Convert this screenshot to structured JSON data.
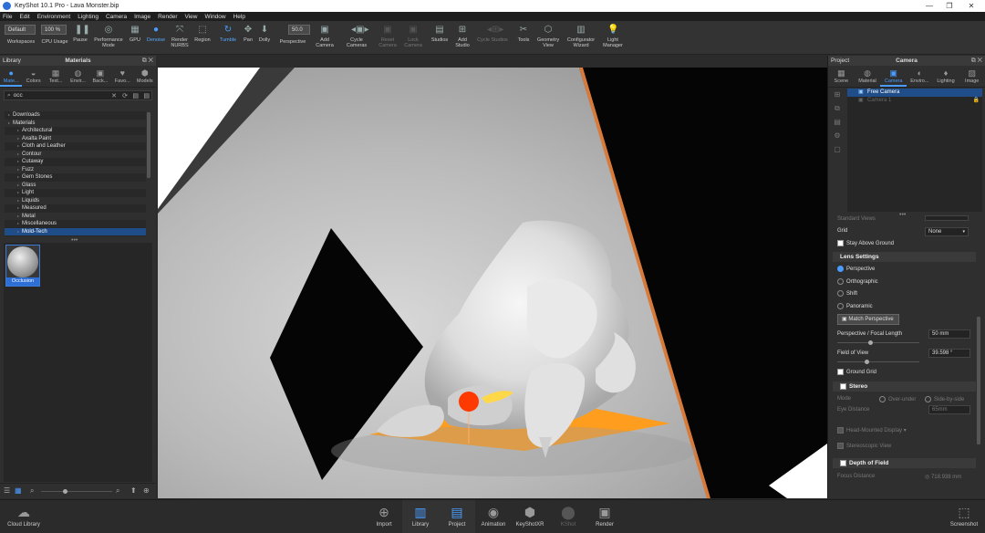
{
  "window": {
    "title": "KeyShot 10.1 Pro  - Lava Monster.bip",
    "minimize": "—",
    "maximize": "❐",
    "close": "✕"
  },
  "menu": [
    "File",
    "Edit",
    "Environment",
    "Lighting",
    "Camera",
    "Image",
    "Render",
    "View",
    "Window",
    "Help"
  ],
  "toolbar": {
    "workspace_value": "Default",
    "workspaces": "Workspaces",
    "cpu_value": "100 %",
    "cpu_usage": "CPU Usage",
    "pause": "Pause",
    "performance_mode": "Performance Mode",
    "gpu": "GPU",
    "denoise": "Denoise",
    "render_nurbs": "Render NURBS",
    "region": "Region",
    "tumble": "Tumble",
    "pan": "Pan",
    "dolly": "Dolly",
    "perspective_value": "50.0",
    "perspective": "Perspective",
    "add_camera": "Add Camera",
    "cycle_cameras": "Cycle Cameras",
    "reset_camera": "Reset Camera",
    "lock_camera": "Lock Camera",
    "studios": "Studios",
    "add_studio": "Add Studio",
    "cycle_studios": "Cycle Studios",
    "tools": "Tools",
    "geometry_view": "Geometry View",
    "configurator_wizard": "Configurator Wizard",
    "light_manager": "Light Manager"
  },
  "library": {
    "panel_label": "Library",
    "title": "Materials",
    "tabs": [
      "Mate...",
      "Colors",
      "Text...",
      "Envir...",
      "Back...",
      "Favo...",
      "Models"
    ],
    "search_value": "occ",
    "tree": [
      {
        "label": "Downloads",
        "depth": 0
      },
      {
        "label": "Materials",
        "depth": 0
      },
      {
        "label": "Architectural",
        "depth": 1
      },
      {
        "label": "Axalta Paint",
        "depth": 1
      },
      {
        "label": "Cloth and Leather",
        "depth": 1
      },
      {
        "label": "Contour",
        "depth": 1
      },
      {
        "label": "Cutaway",
        "depth": 1
      },
      {
        "label": "Fuzz",
        "depth": 1
      },
      {
        "label": "Gem Stones",
        "depth": 1
      },
      {
        "label": "Glass",
        "depth": 1
      },
      {
        "label": "Light",
        "depth": 1
      },
      {
        "label": "Liquids",
        "depth": 1
      },
      {
        "label": "Measured",
        "depth": 1
      },
      {
        "label": "Metal",
        "depth": 1
      },
      {
        "label": "Miscellaneous",
        "depth": 1
      },
      {
        "label": "Mold-Tech",
        "depth": 1,
        "selected": true
      }
    ],
    "thumbnail_label": "Occlusion"
  },
  "project": {
    "panel_label": "Project",
    "title": "Camera",
    "tabs": [
      "Scene",
      "Material",
      "Camera",
      "Enviro...",
      "Lighting",
      "Image"
    ],
    "cameras": [
      {
        "label": "Free Camera",
        "selected": true
      },
      {
        "label": "Camera 1",
        "selected": false
      }
    ],
    "partial_label": "Standard Views",
    "grid_label": "Grid",
    "grid_value": "None",
    "stay_above_ground": "Stay Above Ground",
    "lens_settings": "Lens Settings",
    "lens_options": [
      "Perspective",
      "Orthographic",
      "Shift",
      "Panoramic"
    ],
    "match_perspective": "Match Perspective",
    "focal_length_label": "Perspective / Focal Length",
    "focal_length_value": "50 mm",
    "fov_label": "Field of View",
    "fov_value": "39.598 °",
    "ground_grid": "Ground Grid",
    "stereo": "Stereo",
    "mode_label": "Mode",
    "mode_options": [
      "Over-under",
      "Side-by-side"
    ],
    "eye_distance_label": "Eye Distance",
    "eye_distance_value": "65mm",
    "head_mounted": "Head-Mounted Display",
    "stereoscopic_view": "Stereoscopic View",
    "depth_of_field": "Depth of Field",
    "focus_distance_label": "Focus Distance",
    "focus_distance_value": "718.938 mm"
  },
  "bottombar": {
    "cloud_library": "Cloud Library",
    "import": "Import",
    "library": "Library",
    "project": "Project",
    "animation": "Animation",
    "keyshotxr": "KeyShotXR",
    "kbundle": "KShot",
    "render": "Render",
    "screenshot": "Screenshot"
  },
  "colors": {
    "accent": "#4a9dff",
    "selection": "#1f4d8a",
    "lava": "#ff9d1e"
  }
}
